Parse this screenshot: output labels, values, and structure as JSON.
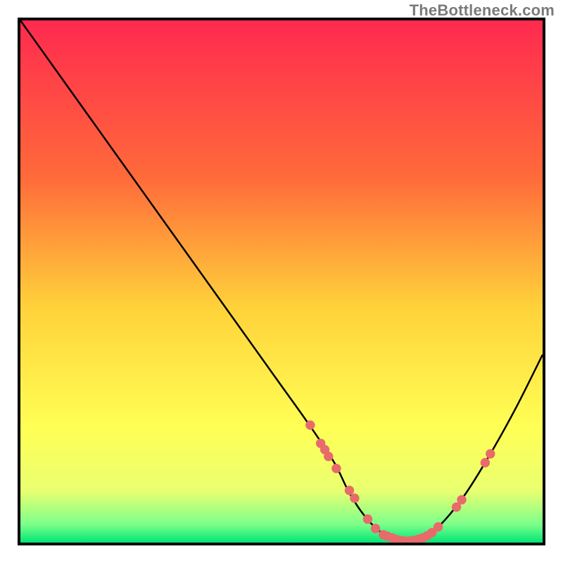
{
  "watermark": "TheBottleneck.com",
  "chart_data": {
    "type": "line",
    "title": "",
    "xlabel": "",
    "ylabel": "",
    "xlim": [
      0,
      100
    ],
    "ylim": [
      0,
      100
    ],
    "grid": false,
    "legend": false,
    "gradient_stops": [
      {
        "offset": 0.0,
        "color": "#ff2a4f"
      },
      {
        "offset": 0.3,
        "color": "#ff6a3a"
      },
      {
        "offset": 0.55,
        "color": "#ffd23a"
      },
      {
        "offset": 0.78,
        "color": "#ffff55"
      },
      {
        "offset": 0.9,
        "color": "#eaff70"
      },
      {
        "offset": 0.965,
        "color": "#7cff8a"
      },
      {
        "offset": 1.0,
        "color": "#00e676"
      }
    ],
    "series": [
      {
        "name": "bottleneck-curve",
        "color": "#000000",
        "stroke_width": 2.5,
        "x": [
          0.0,
          5,
          10,
          15,
          20,
          25,
          30,
          35,
          40,
          45,
          50,
          55,
          60,
          63,
          66,
          69,
          72,
          74,
          76,
          80,
          85,
          90,
          95,
          100
        ],
        "y": [
          100,
          93,
          86,
          79,
          72,
          65,
          58,
          51,
          44,
          37,
          30,
          23,
          15.5,
          9.5,
          5.0,
          2.0,
          0.5,
          0.0,
          0.5,
          3.0,
          9.0,
          17.0,
          26.0,
          36.0
        ]
      }
    ],
    "dots": {
      "color": "#e86a6a",
      "radius_pct": 0.9,
      "points": [
        {
          "x": 55.5,
          "y": 22.5
        },
        {
          "x": 57.5,
          "y": 19.0
        },
        {
          "x": 58.3,
          "y": 17.8
        },
        {
          "x": 59.0,
          "y": 16.5
        },
        {
          "x": 60.5,
          "y": 14.2
        },
        {
          "x": 63.0,
          "y": 10.0
        },
        {
          "x": 64.0,
          "y": 8.5
        },
        {
          "x": 66.5,
          "y": 4.5
        },
        {
          "x": 68.0,
          "y": 2.7
        },
        {
          "x": 69.5,
          "y": 1.5
        },
        {
          "x": 70.3,
          "y": 1.2
        },
        {
          "x": 71.2,
          "y": 0.9
        },
        {
          "x": 72.0,
          "y": 0.6
        },
        {
          "x": 72.8,
          "y": 0.4
        },
        {
          "x": 73.6,
          "y": 0.3
        },
        {
          "x": 74.5,
          "y": 0.3
        },
        {
          "x": 75.3,
          "y": 0.4
        },
        {
          "x": 76.1,
          "y": 0.6
        },
        {
          "x": 77.0,
          "y": 0.9
        },
        {
          "x": 77.9,
          "y": 1.3
        },
        {
          "x": 78.8,
          "y": 1.9
        },
        {
          "x": 80.0,
          "y": 3.0
        },
        {
          "x": 83.5,
          "y": 6.8
        },
        {
          "x": 84.5,
          "y": 8.2
        },
        {
          "x": 89.0,
          "y": 15.3
        },
        {
          "x": 90.0,
          "y": 17.0
        }
      ]
    }
  }
}
